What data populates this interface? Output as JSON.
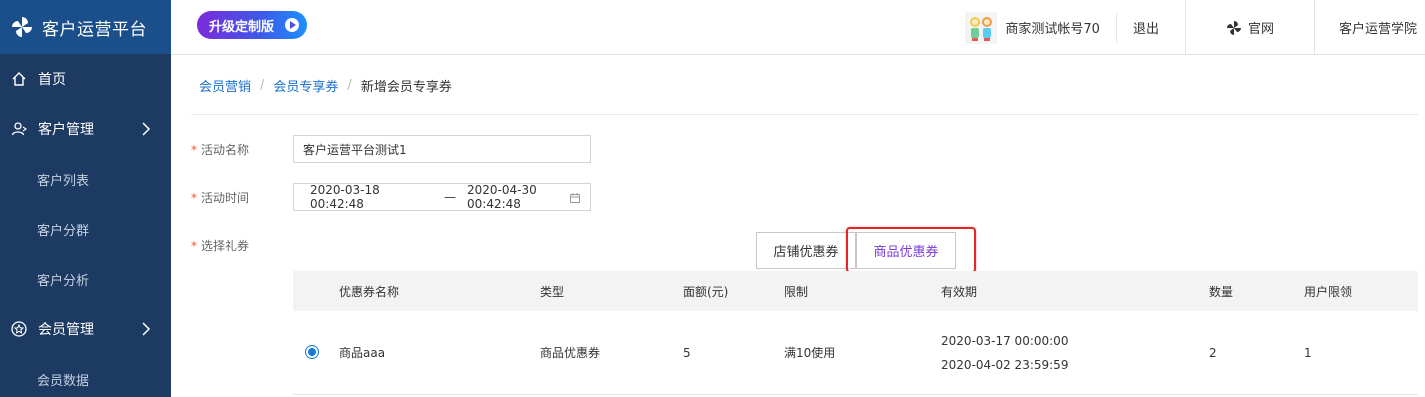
{
  "app": {
    "title": "客户运营平台"
  },
  "sidebar": {
    "items": [
      {
        "label": "首页",
        "icon": "home-icon"
      },
      {
        "label": "客户管理",
        "icon": "customers-icon"
      },
      {
        "label": "客户列表"
      },
      {
        "label": "客户分群"
      },
      {
        "label": "客户分析"
      },
      {
        "label": "会员管理",
        "icon": "member-star-icon"
      },
      {
        "label": "会员数据"
      }
    ]
  },
  "header": {
    "upgrade_label": "升级定制版",
    "account_name": "商家测试帐号70",
    "logout_label": "退出",
    "official_label": "官网",
    "academy_label": "客户运营学院"
  },
  "breadcrumb": {
    "items": [
      "会员营销",
      "会员专享券",
      "新增会员专享券"
    ],
    "separator": "/"
  },
  "form": {
    "required_mark": "*",
    "activity_name_label": "活动名称",
    "activity_name_value": "客户运营平台测试1",
    "activity_time_label": "活动时间",
    "start_time": "2020-03-18 00:42:48",
    "range_separator": "—",
    "end_time": "2020-04-30 00:42:48",
    "coupon_label": "选择礼券"
  },
  "coupon_tabs": {
    "store_label": "店铺优惠券",
    "goods_label": "商品优惠券",
    "active": "goods"
  },
  "table": {
    "headers": [
      "优惠券名称",
      "类型",
      "面额(元)",
      "限制",
      "有效期",
      "数量",
      "用户限领"
    ],
    "rows": [
      {
        "selected": true,
        "name": "商品aaa",
        "type": "商品优惠券",
        "amount": "5",
        "limit": "满10使用",
        "valid_from": "2020-03-17 00:00:00",
        "valid_to": "2020-04-02 23:59:59",
        "quantity": "2",
        "per_user": "1"
      }
    ]
  },
  "colors": {
    "sidebar_bg": "#1d3a63",
    "logo_bg": "#1a4f8c",
    "link": "#1a6fcf",
    "highlight": "#e0252b",
    "active_tab_text": "#7a3bd6",
    "required": "#f25a23"
  }
}
